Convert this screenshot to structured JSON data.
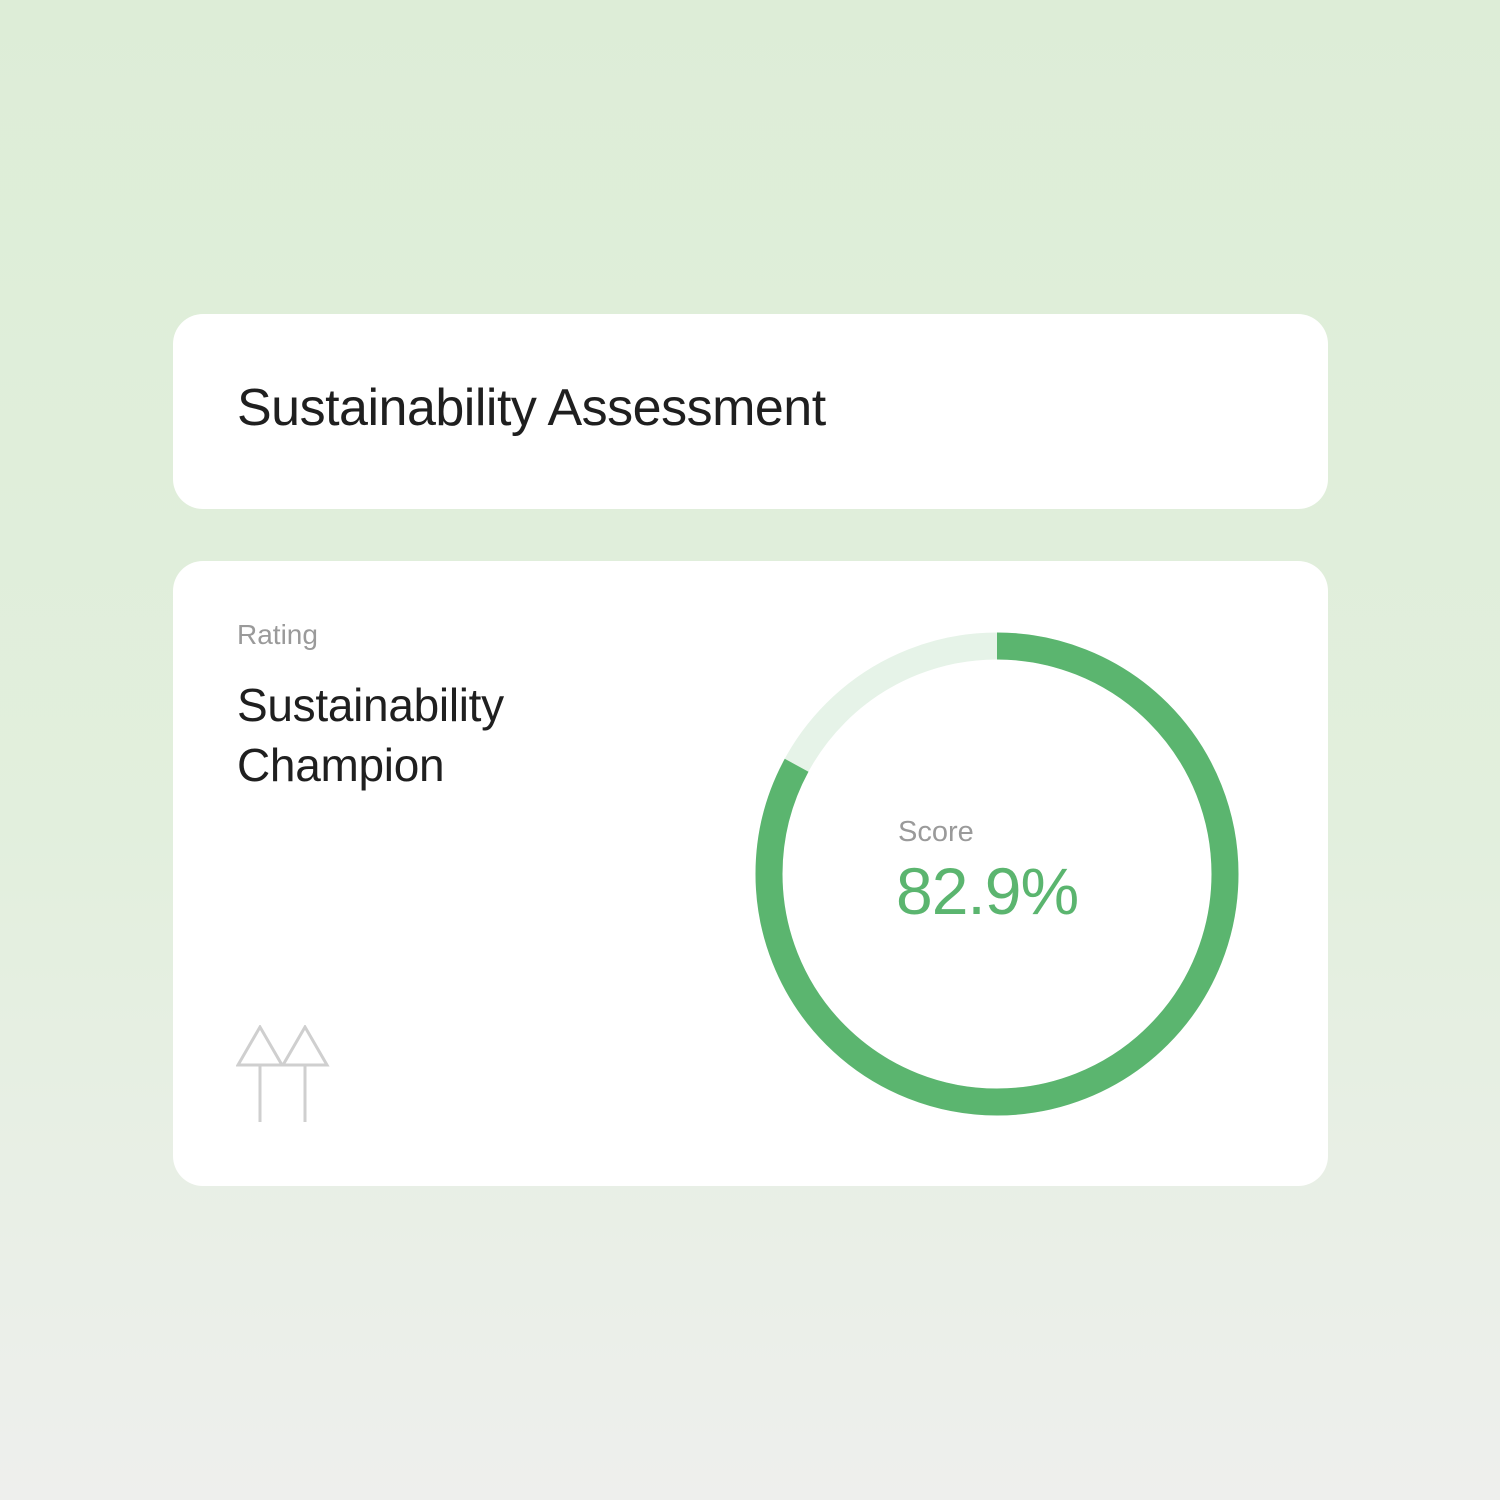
{
  "header": {
    "title": "Sustainability Assessment"
  },
  "rating": {
    "label": "Rating",
    "value": "Sustainability Champion"
  },
  "score": {
    "label": "Score",
    "value_text": "82.9%",
    "fraction": 0.829
  },
  "colors": {
    "accent": "#5bb56f",
    "track": "#e6f3e8",
    "background_top": "#ddedd7",
    "background_bottom": "#eeefed"
  },
  "icons": {
    "growth": "double-up-arrow-icon"
  }
}
